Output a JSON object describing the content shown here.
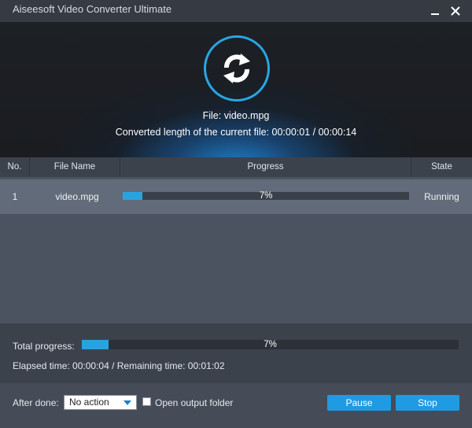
{
  "window": {
    "title": "Aiseesoft Video Converter Ultimate",
    "minimize_icon": "minimize-icon",
    "close_icon": "close-icon"
  },
  "hero": {
    "icon": "refresh-icon",
    "file_line": "File: video.mpg",
    "length_line": "Converted length of the current file: 00:00:01 / 00:00:14",
    "accent_color": "#27a6e6"
  },
  "table": {
    "headers": [
      "No.",
      "File Name",
      "Progress",
      "State"
    ],
    "rows": [
      {
        "no": "1",
        "file_name": "video.mpg",
        "progress": 0.07,
        "progress_label": "7%",
        "state": "Running"
      }
    ]
  },
  "total": {
    "label": "Total progress:",
    "progress": 0.07,
    "progress_label": "7%",
    "elapsed_line": "Elapsed time: 00:00:04 / Remaining time: 00:01:02"
  },
  "bottom": {
    "after_done_label": "After done:",
    "after_done_selected": "No action",
    "open_folder_label": "Open output folder",
    "open_folder_checked": false,
    "pause_label": "Pause",
    "stop_label": "Stop"
  },
  "colors": {
    "accent": "#1f9be3",
    "progress_fill": "#29a3df"
  }
}
